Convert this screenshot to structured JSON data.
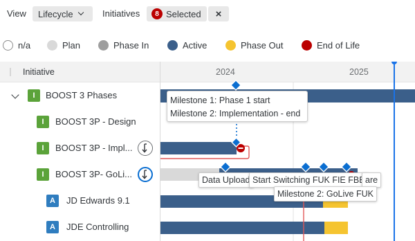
{
  "toolbar": {
    "view_label": "View",
    "view_value": "Lifecycle",
    "initiatives_label": "Initiatives",
    "selected_count": "8",
    "selected_label": "Selected",
    "clear_icon": "×"
  },
  "legend": [
    {
      "label": "n/a",
      "color": "#ffffff",
      "border": "#8c8c8c"
    },
    {
      "label": "Plan",
      "color": "#d9d9d9",
      "border": "#d9d9d9"
    },
    {
      "label": "Phase In",
      "color": "#9e9e9e",
      "border": "#9e9e9e"
    },
    {
      "label": "Active",
      "color": "#3b5f8a",
      "border": "#3b5f8a"
    },
    {
      "label": "Phase Out",
      "color": "#f5c430",
      "border": "#f5c430"
    },
    {
      "label": "End of Life",
      "color": "#bb0000",
      "border": "#bb0000"
    }
  ],
  "grid": {
    "header": "Initiative",
    "years": [
      "2024",
      "2025"
    ]
  },
  "rows": [
    {
      "type": "I",
      "label": "BOOST 3 Phases",
      "expanded": true,
      "dependency": null
    },
    {
      "type": "I",
      "label": "BOOST 3P - Design",
      "dependency": null
    },
    {
      "type": "I",
      "label": "BOOST 3P - Impl...",
      "dependency": "normal"
    },
    {
      "type": "I",
      "label": "BOOST 3P- GoLi...",
      "dependency": "active"
    },
    {
      "type": "A",
      "label": "JD Edwards 9.1",
      "dependency": null
    },
    {
      "type": "A",
      "label": "JDE Controlling",
      "dependency": null
    }
  ],
  "tooltips": {
    "milestone1": "Milestone 1: Phase 1 start",
    "milestone2": "Milestone 2: Implementation - end",
    "data_upload": "Data Upload",
    "start_switching": "Start Switching FUK FIE FBE",
    "are": "are",
    "golive": "Milestone 2: GoLive FUK"
  },
  "colors": {
    "active": "#3b5f8a",
    "plan": "#d9d9d9",
    "phase_out": "#f5c430",
    "end_of_life": "#bb0000",
    "milestone": "#0a6ed1",
    "today": "#1a73e8"
  }
}
